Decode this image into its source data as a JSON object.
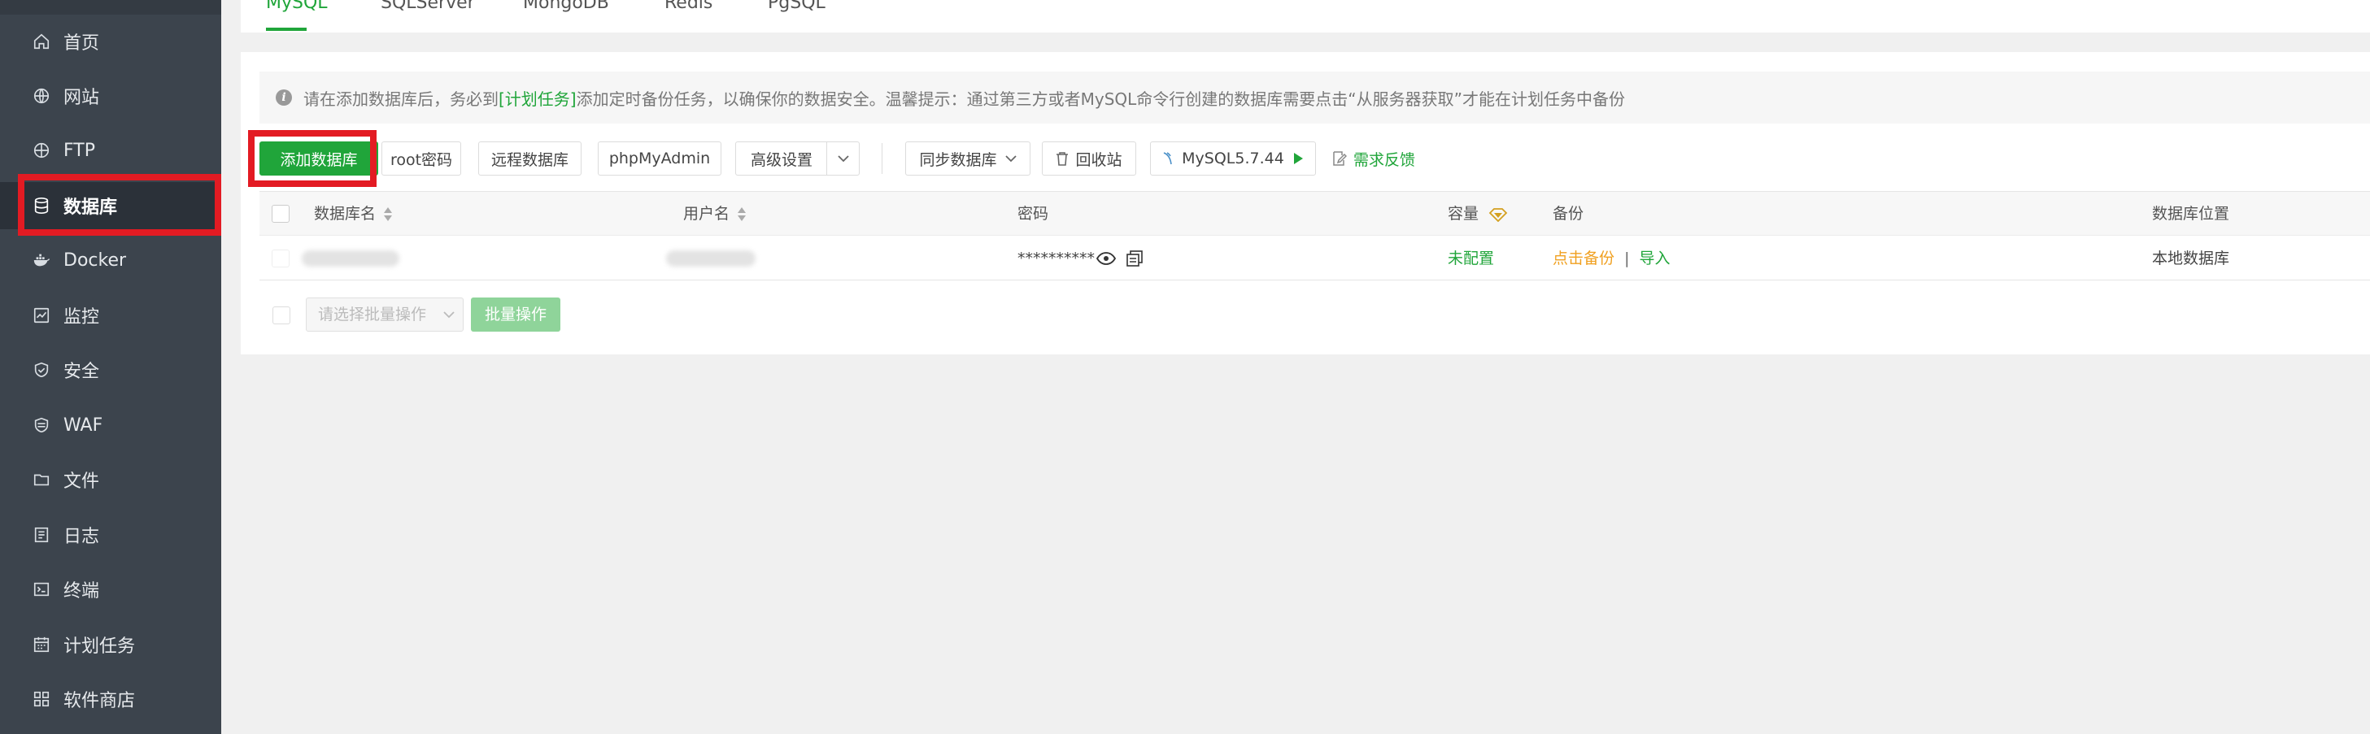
{
  "sidebar": {
    "items": [
      {
        "label": "首页",
        "icon": "home-icon"
      },
      {
        "label": "网站",
        "icon": "globe-icon"
      },
      {
        "label": "FTP",
        "icon": "ftp-icon"
      },
      {
        "label": "数据库",
        "icon": "database-icon",
        "active": true
      },
      {
        "label": "Docker",
        "icon": "docker-icon"
      },
      {
        "label": "监控",
        "icon": "monitor-icon"
      },
      {
        "label": "安全",
        "icon": "shield-icon"
      },
      {
        "label": "WAF",
        "icon": "waf-icon"
      },
      {
        "label": "文件",
        "icon": "folder-icon"
      },
      {
        "label": "日志",
        "icon": "log-icon"
      },
      {
        "label": "终端",
        "icon": "terminal-icon"
      },
      {
        "label": "计划任务",
        "icon": "calendar-icon"
      },
      {
        "label": "软件商店",
        "icon": "grid-icon"
      }
    ]
  },
  "tabs": [
    {
      "label": "MySQL",
      "active": true
    },
    {
      "label": "SQLServer"
    },
    {
      "label": "MongoDB"
    },
    {
      "label": "Redis"
    },
    {
      "label": "PgSQL"
    }
  ],
  "notice": {
    "before": "请在添加数据库后，务必到",
    "link": "[计划任务]",
    "after": "添加定时备份任务，以确保你的数据安全。温馨提示：通过第三方或者MySQL命令行创建的数据库需要点击“从服务器获取”才能在计划任务中备份"
  },
  "toolbar": {
    "add": "添加数据库",
    "root_password": "root密码",
    "remote_db": "远程数据库",
    "phpmyadmin": "phpMyAdmin",
    "advanced": "高级设置",
    "sync": "同步数据库",
    "recycle": "回收站",
    "version": "MySQL5.7.44",
    "feedback": "需求反馈"
  },
  "table": {
    "headers": {
      "name": "数据库名",
      "user": "用户名",
      "password": "密码",
      "capacity": "容量",
      "backup": "备份",
      "location": "数据库位置"
    },
    "rows": [
      {
        "password": "**********",
        "capacity": "未配置",
        "backup_action": "点击备份",
        "separator": "|",
        "import": "导入",
        "location": "本地数据库"
      }
    ]
  },
  "bulk": {
    "placeholder": "请选择批量操作",
    "button": "批量操作"
  },
  "colors": {
    "accent": "#20a53a",
    "sidebar": "#3c444d",
    "highlight": "#e31b23",
    "warning": "#f0a020"
  }
}
